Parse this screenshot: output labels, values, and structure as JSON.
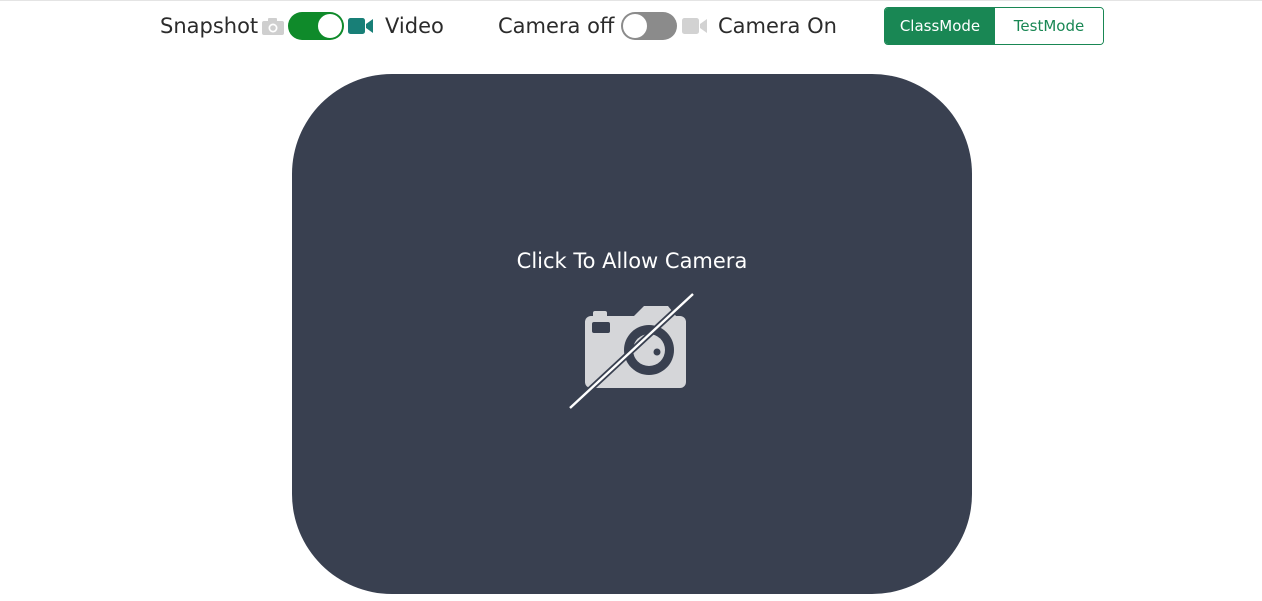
{
  "capture_mode": {
    "left_label": "Snapshot",
    "right_label": "Video",
    "state": "on",
    "accent_color": "#0f8a2a",
    "left_icon": "camera-icon",
    "right_icon": "video-camera-icon"
  },
  "camera_power": {
    "left_label": "Camera off",
    "right_label": "Camera On",
    "state": "off",
    "icon": "video-camera-icon"
  },
  "mode_group": {
    "class_mode_label": "ClassMode",
    "test_mode_label": "TestMode",
    "selected": "ClassMode",
    "accent_color": "#198754"
  },
  "camera_panel": {
    "prompt": "Click To Allow Camera",
    "icon": "camera-off-icon",
    "background_color": "#394050"
  }
}
